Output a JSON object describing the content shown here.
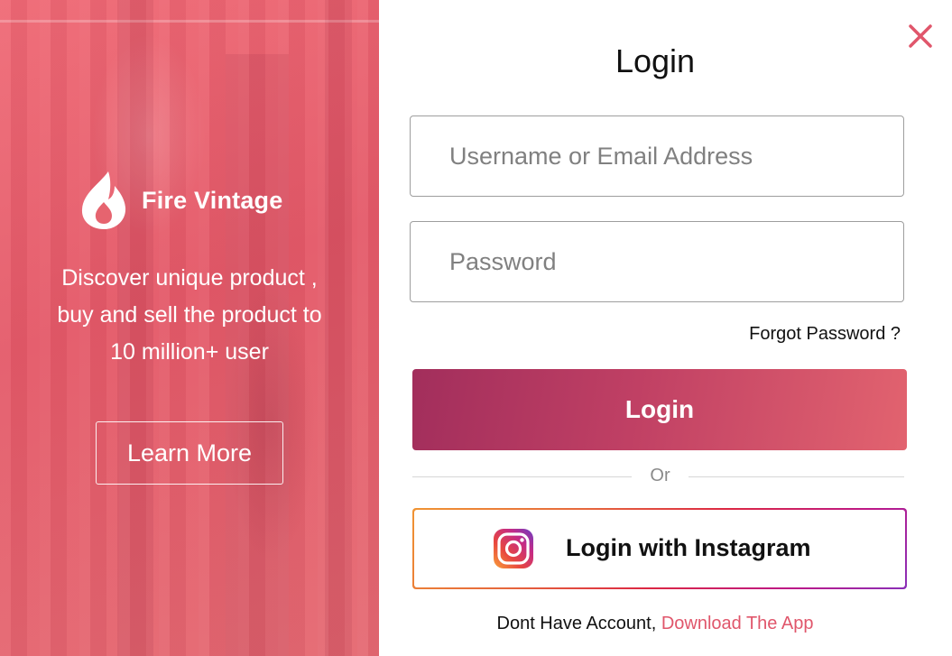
{
  "colors": {
    "brand_coral": "#e45a69",
    "login_gradient_start": "#a22e5c",
    "login_gradient_end": "#e2636f",
    "close_icon": "#e0566b",
    "link": "#e0566b"
  },
  "hero": {
    "brand_name": "Fire Vintage",
    "brand_icon": "flame-icon",
    "tagline_lines": [
      "Discover unique product ,",
      "buy and sell the product to",
      "10 million+ user"
    ],
    "learn_more_label": "Learn More"
  },
  "login": {
    "title": "Login",
    "close_icon": "close-icon",
    "username_placeholder": "Username or Email Address",
    "password_placeholder": "Password",
    "forgot_label": "Forgot Password ?",
    "submit_label": "Login",
    "or_label": "Or",
    "instagram_label": "Login with Instagram",
    "instagram_icon": "instagram-icon",
    "signup_prompt": "Dont Have Account, ",
    "signup_link": "Download The App"
  }
}
